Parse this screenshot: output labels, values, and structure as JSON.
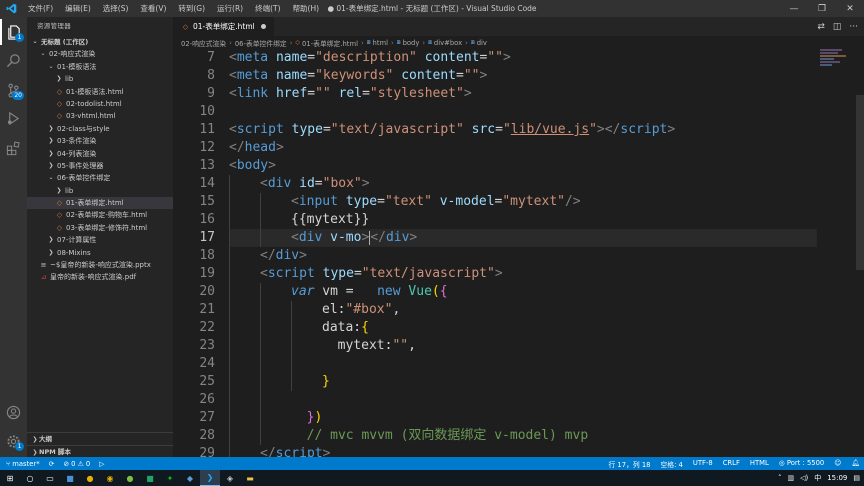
{
  "titlebar": {
    "menu": [
      "文件(F)",
      "编辑(E)",
      "选择(S)",
      "查看(V)",
      "转到(G)",
      "运行(R)",
      "终端(T)",
      "帮助(H)"
    ],
    "title": "● 01-表单绑定.html - 无标题 (工作区) - Visual Studio Code"
  },
  "activity": {
    "explorer_badge": "1",
    "scm_badge": "20",
    "settings_badge": "1"
  },
  "sidebar": {
    "header": "资源管理器",
    "bottom_sections": [
      "大纲",
      "NPM 脚本"
    ],
    "items": [
      {
        "label": "无标题 (工作区)",
        "depth": 0,
        "kind": "root",
        "expanded": true
      },
      {
        "label": "02-响应式渲染",
        "depth": 1,
        "kind": "folder",
        "expanded": true
      },
      {
        "label": "01-模板语法",
        "depth": 2,
        "kind": "folder",
        "expanded": true
      },
      {
        "label": "lib",
        "depth": 3,
        "kind": "folder",
        "expanded": false
      },
      {
        "label": "01-模板语法.html",
        "depth": 3,
        "kind": "html"
      },
      {
        "label": "02-todolist.html",
        "depth": 3,
        "kind": "html"
      },
      {
        "label": "03-vhtml.html",
        "depth": 3,
        "kind": "html"
      },
      {
        "label": "02-class与style",
        "depth": 2,
        "kind": "folder",
        "expanded": false
      },
      {
        "label": "03-条件渲染",
        "depth": 2,
        "kind": "folder",
        "expanded": false
      },
      {
        "label": "04-列表渲染",
        "depth": 2,
        "kind": "folder",
        "expanded": false
      },
      {
        "label": "05-事件处理器",
        "depth": 2,
        "kind": "folder",
        "expanded": false
      },
      {
        "label": "06-表单控件绑定",
        "depth": 2,
        "kind": "folder",
        "expanded": true
      },
      {
        "label": "lib",
        "depth": 3,
        "kind": "folder",
        "expanded": false
      },
      {
        "label": "01-表单绑定.html",
        "depth": 3,
        "kind": "html",
        "selected": true
      },
      {
        "label": "02-表单绑定-购物车.html",
        "depth": 3,
        "kind": "html"
      },
      {
        "label": "03-表单绑定-修饰符.html",
        "depth": 3,
        "kind": "html"
      },
      {
        "label": "07-计算属性",
        "depth": 2,
        "kind": "folder",
        "expanded": false
      },
      {
        "label": "08-Mixins",
        "depth": 2,
        "kind": "folder",
        "expanded": false
      },
      {
        "label": "~$皇帝的新装-响应式渲染.pptx",
        "depth": 1,
        "kind": "ppt"
      },
      {
        "label": "皇帝的新装-响应式渲染.pdf",
        "depth": 1,
        "kind": "pdf"
      }
    ]
  },
  "tab": {
    "label": "01-表单绑定.html"
  },
  "breadcrumb": [
    "02-响应式渲染",
    "06-表单控件绑定",
    "01-表单绑定.html",
    "html",
    "body",
    "div#box",
    "div"
  ],
  "editor": {
    "lines": [
      {
        "n": "7",
        "indent": 0,
        "tokens": [
          [
            "br",
            "<"
          ],
          [
            "tag",
            "meta"
          ],
          [
            "txt",
            " "
          ],
          [
            "attr",
            "name"
          ],
          [
            "txt",
            "="
          ],
          [
            "str",
            "\"description\""
          ],
          [
            "txt",
            " "
          ],
          [
            "attr",
            "content"
          ],
          [
            "txt",
            "="
          ],
          [
            "str",
            "\"\""
          ],
          [
            "br",
            ">"
          ]
        ]
      },
      {
        "n": "8",
        "indent": 0,
        "tokens": [
          [
            "br",
            "<"
          ],
          [
            "tag",
            "meta"
          ],
          [
            "txt",
            " "
          ],
          [
            "attr",
            "name"
          ],
          [
            "txt",
            "="
          ],
          [
            "str",
            "\"keywords\""
          ],
          [
            "txt",
            " "
          ],
          [
            "attr",
            "content"
          ],
          [
            "txt",
            "="
          ],
          [
            "str",
            "\"\""
          ],
          [
            "br",
            ">"
          ]
        ]
      },
      {
        "n": "9",
        "indent": 0,
        "tokens": [
          [
            "br",
            "<"
          ],
          [
            "tag",
            "link"
          ],
          [
            "txt",
            " "
          ],
          [
            "attr",
            "href"
          ],
          [
            "txt",
            "="
          ],
          [
            "str",
            "\"\""
          ],
          [
            "txt",
            " "
          ],
          [
            "attr",
            "rel"
          ],
          [
            "txt",
            "="
          ],
          [
            "str",
            "\"stylesheet\""
          ],
          [
            "br",
            ">"
          ]
        ]
      },
      {
        "n": "10",
        "indent": 0,
        "tokens": []
      },
      {
        "n": "11",
        "indent": 0,
        "tokens": [
          [
            "br",
            "<"
          ],
          [
            "tag",
            "script"
          ],
          [
            "txt",
            " "
          ],
          [
            "attr",
            "type"
          ],
          [
            "txt",
            "="
          ],
          [
            "str",
            "\"text/javascript\""
          ],
          [
            "txt",
            " "
          ],
          [
            "attr",
            "src"
          ],
          [
            "txt",
            "="
          ],
          [
            "str",
            "\""
          ],
          [
            "url",
            "lib/vue.js"
          ],
          [
            "str",
            "\""
          ],
          [
            "br",
            "></"
          ],
          [
            "tag",
            "script"
          ],
          [
            "br",
            ">"
          ]
        ]
      },
      {
        "n": "12",
        "indent": 0,
        "tokens": [
          [
            "br",
            "</"
          ],
          [
            "tag",
            "head"
          ],
          [
            "br",
            ">"
          ]
        ]
      },
      {
        "n": "13",
        "indent": 0,
        "tokens": [
          [
            "br",
            "<"
          ],
          [
            "tag",
            "body"
          ],
          [
            "br",
            ">"
          ]
        ]
      },
      {
        "n": "14",
        "indent": 1,
        "tokens": [
          [
            "br",
            "<"
          ],
          [
            "tag",
            "div"
          ],
          [
            "txt",
            " "
          ],
          [
            "attr",
            "id"
          ],
          [
            "txt",
            "="
          ],
          [
            "str",
            "\"box\""
          ],
          [
            "br",
            ">"
          ]
        ]
      },
      {
        "n": "15",
        "indent": 2,
        "tokens": [
          [
            "br",
            "<"
          ],
          [
            "tag",
            "input"
          ],
          [
            "txt",
            " "
          ],
          [
            "attr",
            "type"
          ],
          [
            "txt",
            "="
          ],
          [
            "str",
            "\"text\""
          ],
          [
            "txt",
            " "
          ],
          [
            "attr",
            "v-model"
          ],
          [
            "txt",
            "="
          ],
          [
            "str",
            "\"mytext\""
          ],
          [
            "br",
            "/>"
          ]
        ]
      },
      {
        "n": "16",
        "indent": 2,
        "tokens": [
          [
            "txt",
            "{{mytext}}"
          ]
        ]
      },
      {
        "n": "17",
        "indent": 2,
        "current": true,
        "tokens": [
          [
            "br",
            "<"
          ],
          [
            "tag",
            "div"
          ],
          [
            "txt",
            " "
          ],
          [
            "attr",
            "v-mo"
          ],
          [
            "br",
            ">"
          ],
          [
            "cursor",
            ""
          ],
          [
            "br",
            "</"
          ],
          [
            "tag",
            "div"
          ],
          [
            "br",
            ">"
          ]
        ]
      },
      {
        "n": "18",
        "indent": 1,
        "tokens": [
          [
            "br",
            "</"
          ],
          [
            "tag",
            "div"
          ],
          [
            "br",
            ">"
          ]
        ]
      },
      {
        "n": "19",
        "indent": 1,
        "tokens": [
          [
            "br",
            "<"
          ],
          [
            "tag",
            "script"
          ],
          [
            "txt",
            " "
          ],
          [
            "attr",
            "type"
          ],
          [
            "txt",
            "="
          ],
          [
            "str",
            "\"text/javascript\""
          ],
          [
            "br",
            ">"
          ]
        ]
      },
      {
        "n": "20",
        "indent": 2,
        "tokens": [
          [
            "kw",
            "var"
          ],
          [
            "txt",
            " vm =   "
          ],
          [
            "tag",
            "new"
          ],
          [
            "txt",
            " "
          ],
          [
            "fn",
            "Vue"
          ],
          [
            "par",
            "("
          ],
          [
            "brace",
            "{"
          ]
        ]
      },
      {
        "n": "21",
        "indent": 3,
        "tokens": [
          [
            "txt",
            "el:"
          ],
          [
            "str",
            "\"#box\""
          ],
          [
            "txt",
            ","
          ]
        ]
      },
      {
        "n": "22",
        "indent": 3,
        "tokens": [
          [
            "txt",
            "data:"
          ],
          [
            "par",
            "{"
          ]
        ]
      },
      {
        "n": "23",
        "indent": 3,
        "tokens": [
          [
            "txt",
            "  mytext:"
          ],
          [
            "str",
            "\"\""
          ],
          [
            "txt",
            ","
          ]
        ]
      },
      {
        "n": "24",
        "indent": 3,
        "tokens": []
      },
      {
        "n": "25",
        "indent": 3,
        "tokens": [
          [
            "par",
            "}"
          ]
        ]
      },
      {
        "n": "26",
        "indent": 2,
        "tokens": []
      },
      {
        "n": "27",
        "indent": 2,
        "tokens": [
          [
            "txt",
            "  "
          ],
          [
            "brace",
            "}"
          ],
          [
            "par",
            ")"
          ]
        ]
      },
      {
        "n": "28",
        "indent": 2,
        "tokens": [
          [
            "cm",
            "  // mvc mvvm (双向数据绑定 v-model) mvp"
          ]
        ]
      },
      {
        "n": "29",
        "indent": 1,
        "tokens": [
          [
            "br",
            "</"
          ],
          [
            "tag",
            "script"
          ],
          [
            "br",
            ">"
          ]
        ]
      }
    ]
  },
  "statusbar": {
    "branch": "master*",
    "errors": "⊘ 0 ⚠ 0",
    "position": "行 17，列 18",
    "spaces": "空格: 4",
    "encoding": "UTF-8",
    "eol": "CRLF",
    "language": "HTML",
    "port": "Port : 5500"
  },
  "taskbar": {
    "lang": "中",
    "time": "15:09"
  }
}
